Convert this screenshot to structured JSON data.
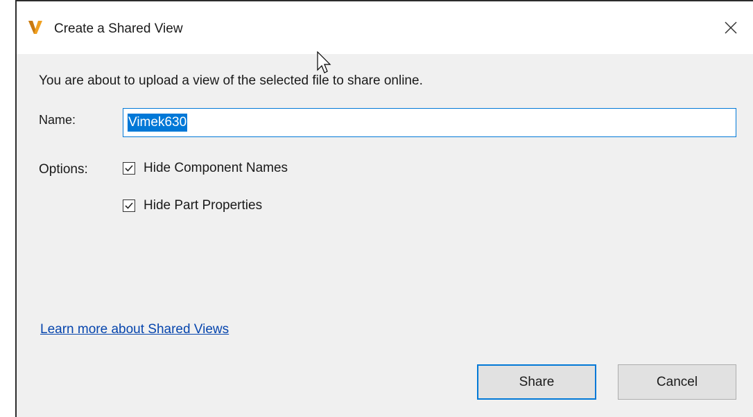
{
  "window": {
    "title": "Create a Shared View",
    "app_icon": "autodesk-v-logo-icon",
    "close_icon": "close-icon"
  },
  "dialog": {
    "description": "You are about to upload a view of the selected file to share online.",
    "name_label": "Name:",
    "name_value": "Vimek630",
    "options_label": "Options:",
    "options": [
      {
        "label": "Hide Component Names",
        "checked": true
      },
      {
        "label": "Hide Part Properties",
        "checked": true
      }
    ],
    "learn_more_link": "Learn more about Shared Views"
  },
  "buttons": {
    "share_label": "Share",
    "cancel_label": "Cancel"
  },
  "colors": {
    "accent": "#0078d7",
    "link": "#0645ad",
    "logo": "#f0a020"
  }
}
